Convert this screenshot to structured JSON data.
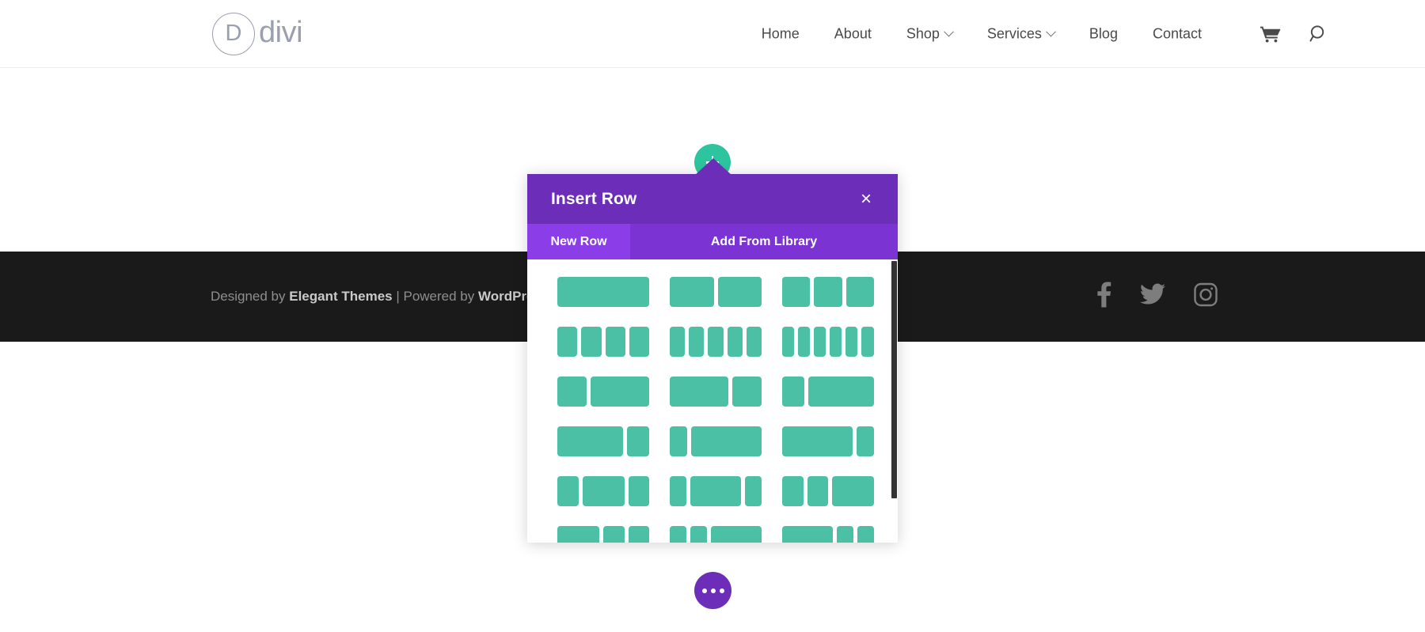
{
  "header": {
    "logo": {
      "mark": "D",
      "text": "divi",
      "icon": "divi-logo-icon"
    },
    "nav": [
      {
        "label": "Home",
        "has_dropdown": false
      },
      {
        "label": "About",
        "has_dropdown": false
      },
      {
        "label": "Shop",
        "has_dropdown": true
      },
      {
        "label": "Services",
        "has_dropdown": true
      },
      {
        "label": "Blog",
        "has_dropdown": false
      },
      {
        "label": "Contact",
        "has_dropdown": false
      }
    ],
    "icons": [
      {
        "name": "shopping-cart-icon"
      },
      {
        "name": "search-icon"
      }
    ]
  },
  "footer": {
    "credit_prefix": "Designed by ",
    "credit_brand": "Elegant Themes",
    "credit_sep": " | ",
    "credit_middle": "Powered by ",
    "credit_brand2": "WordPress",
    "social": [
      {
        "name": "facebook-icon"
      },
      {
        "name": "twitter-icon"
      },
      {
        "name": "instagram-icon"
      }
    ]
  },
  "builder": {
    "add_row_button": "+",
    "settings_button": "•••"
  },
  "modal": {
    "title": "Insert Row",
    "close_label": "×",
    "tabs": [
      {
        "label": "New Row",
        "active": true
      },
      {
        "label": "Add From Library",
        "active": false
      }
    ],
    "accent_purple": "#6c2eb9",
    "tab_active_purple": "#8b3ee8",
    "tab_inactive_purple": "#7c33d4",
    "column_green": "#4bc0a5",
    "add_button_green": "#2ec4a0",
    "layouts": [
      {
        "name": "1-column",
        "widths": [
          100
        ]
      },
      {
        "name": "2-equal-columns",
        "widths": [
          50,
          50
        ]
      },
      {
        "name": "3-equal-columns",
        "widths": [
          33.33,
          33.33,
          33.33
        ]
      },
      {
        "name": "4-equal-columns",
        "widths": [
          25,
          25,
          25,
          25
        ]
      },
      {
        "name": "5-equal-columns",
        "widths": [
          20,
          20,
          20,
          20,
          20
        ]
      },
      {
        "name": "6-equal-columns",
        "widths": [
          16.6,
          16.6,
          16.6,
          16.6,
          16.6,
          16.6
        ]
      },
      {
        "name": "one-third-two-thirds",
        "widths": [
          33.33,
          66.67
        ]
      },
      {
        "name": "two-thirds-one-third",
        "widths": [
          66.67,
          33.33
        ]
      },
      {
        "name": "one-fourth-three-fourths",
        "widths": [
          25,
          75
        ]
      },
      {
        "name": "three-fourths-one-fourth",
        "widths": [
          75,
          25
        ]
      },
      {
        "name": "one-fifth-four-fifths",
        "widths": [
          20,
          80
        ]
      },
      {
        "name": "four-fifths-one-fifth",
        "widths": [
          80,
          20
        ]
      },
      {
        "name": "one-fourth-half-one-fourth",
        "widths": [
          25,
          50,
          25
        ]
      },
      {
        "name": "one-fifth-three-fifths-one-fifth",
        "widths": [
          20,
          60,
          20
        ]
      },
      {
        "name": "one-fourth-one-fourth-half",
        "widths": [
          25,
          25,
          50
        ]
      },
      {
        "name": "half-one-fourth-one-fourth",
        "widths": [
          50,
          25,
          25
        ]
      },
      {
        "name": "one-fifth-one-fifth-three-fifths",
        "widths": [
          20,
          20,
          60
        ]
      },
      {
        "name": "three-fifths-one-fifth-one-fifth",
        "widths": [
          60,
          20,
          20
        ]
      }
    ]
  }
}
